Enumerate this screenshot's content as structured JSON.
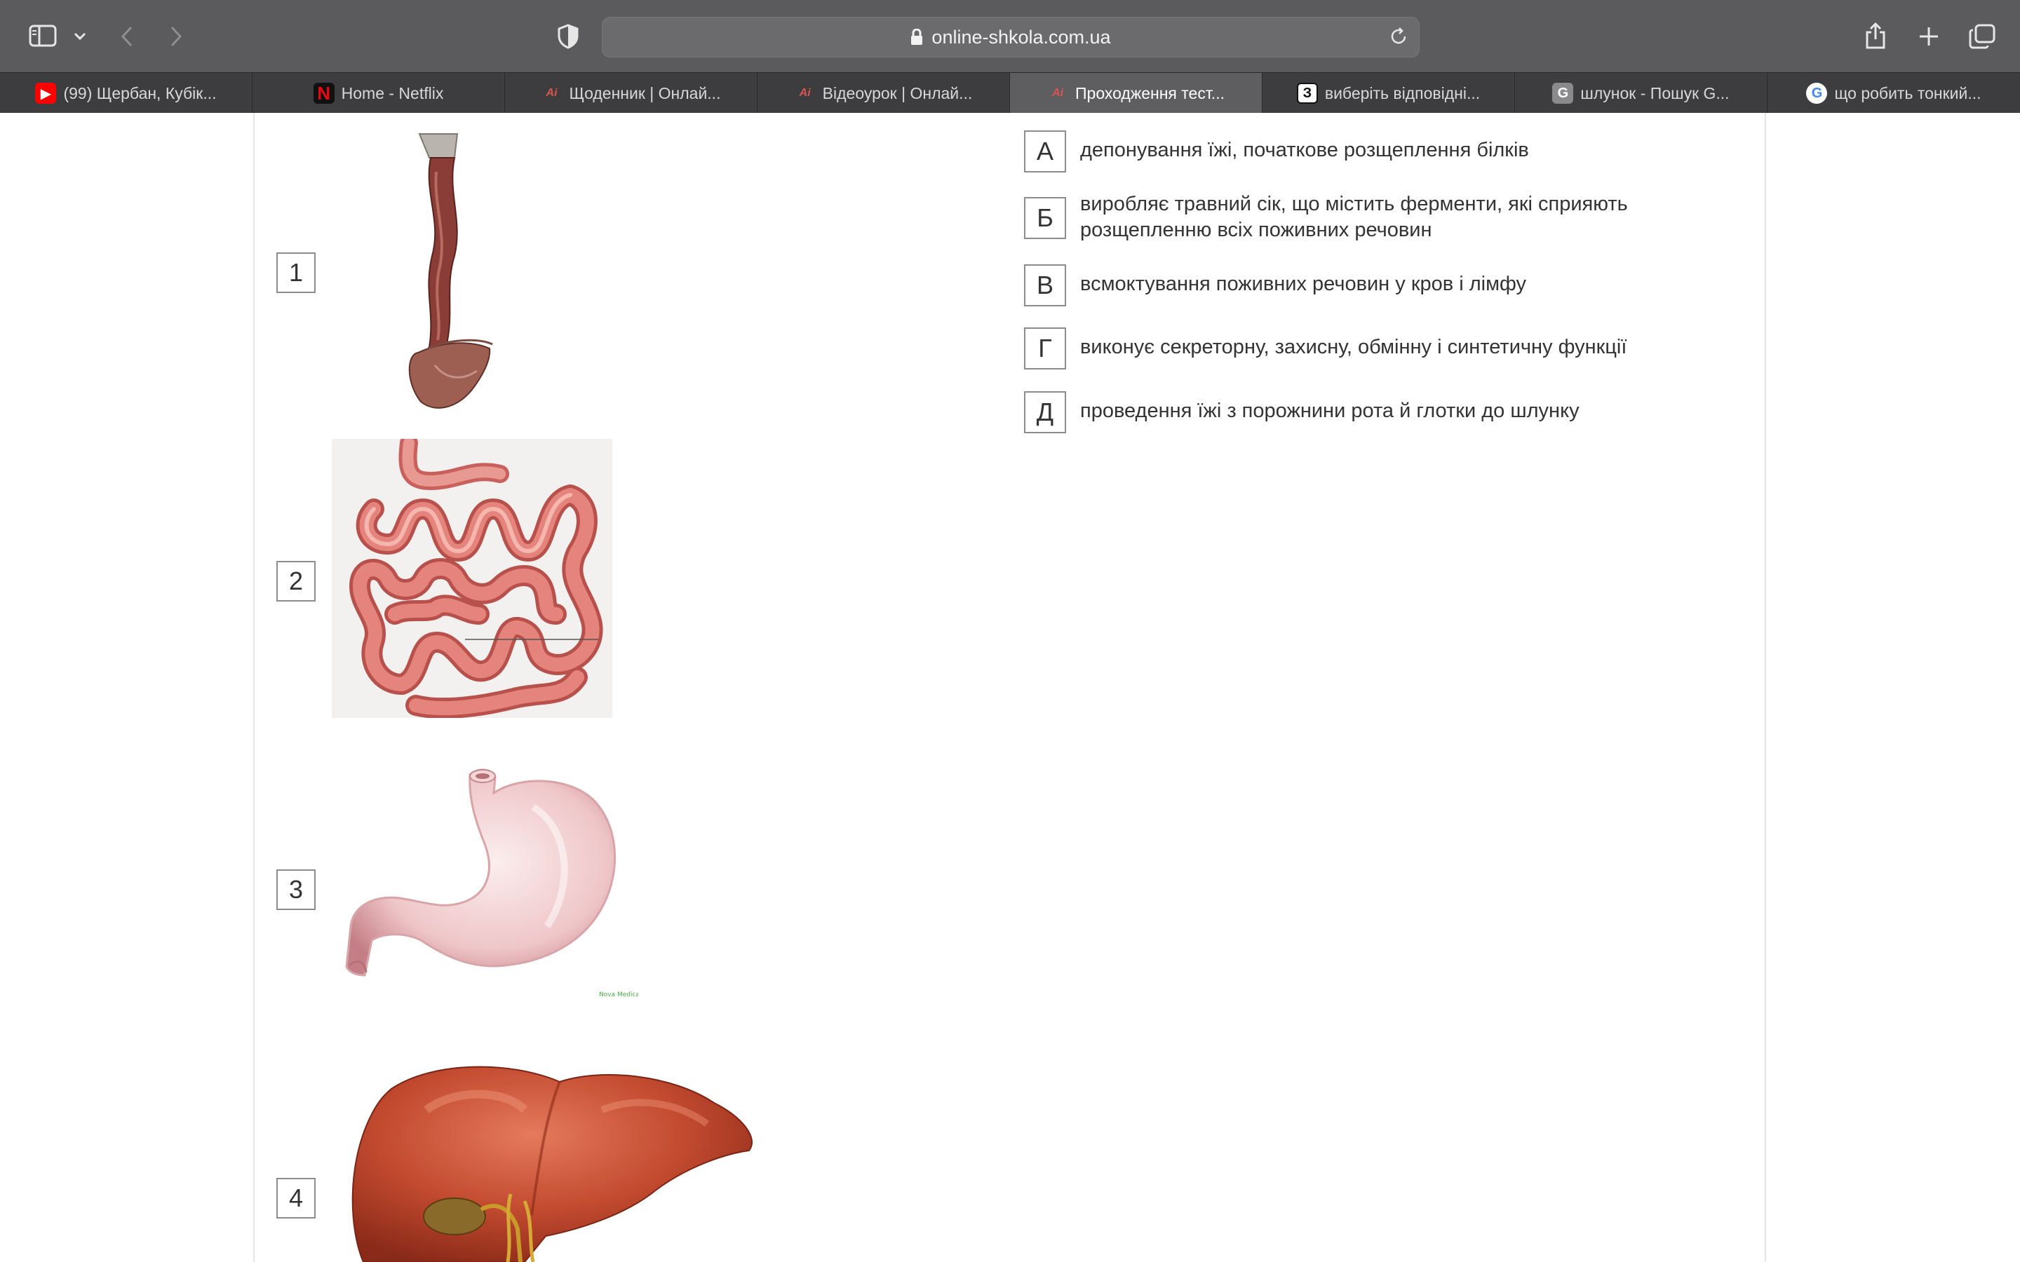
{
  "browser": {
    "url": "online-shkola.com.ua",
    "tabs": [
      {
        "title": "(99) Щербан, Кубік...",
        "icon": "youtube-icon",
        "active": false
      },
      {
        "title": "Home - Netflix",
        "icon": "netflix-icon",
        "active": false
      },
      {
        "title": "Щоденник | Онлай...",
        "icon": "online-shkola-icon",
        "active": false
      },
      {
        "title": "Відеоурок | Онлай...",
        "icon": "online-shkola-icon",
        "active": false
      },
      {
        "title": "Проходження тест...",
        "icon": "online-shkola-icon",
        "active": true
      },
      {
        "title": "виберіть відповідні...",
        "icon": "znanija-icon",
        "active": false
      },
      {
        "title": "шлунок - Пошук G...",
        "icon": "g-icon",
        "active": false
      },
      {
        "title": "що робить тонкий...",
        "icon": "google-icon",
        "active": false
      }
    ]
  },
  "quiz": {
    "items": [
      {
        "number": "1",
        "image": "esophagus-image"
      },
      {
        "number": "2",
        "image": "small-intestine-image"
      },
      {
        "number": "3",
        "image": "stomach-image"
      },
      {
        "number": "4",
        "image": "liver-image"
      }
    ],
    "answers": [
      {
        "letter": "А",
        "text": "депонування їжі, початкове розщеплення білків"
      },
      {
        "letter": "Б",
        "text": "виробляє травний сік, що містить ферменти, які сприяють розщепленню всіх поживних речовин"
      },
      {
        "letter": "В",
        "text": "всмоктування поживних речовин у кров і лімфу"
      },
      {
        "letter": "Г",
        "text": "виконує секреторну, захисну, обмінну і синтетичну функції"
      },
      {
        "letter": "Д",
        "text": "проведення їжі з порожнини рота й глотки до шлунку"
      }
    ]
  },
  "colors": {
    "toolbar": "#5b5b5d",
    "tabstrip": "#3d3d3f",
    "active_tab": "#5e5e61",
    "box_border": "#8c8c8c"
  }
}
